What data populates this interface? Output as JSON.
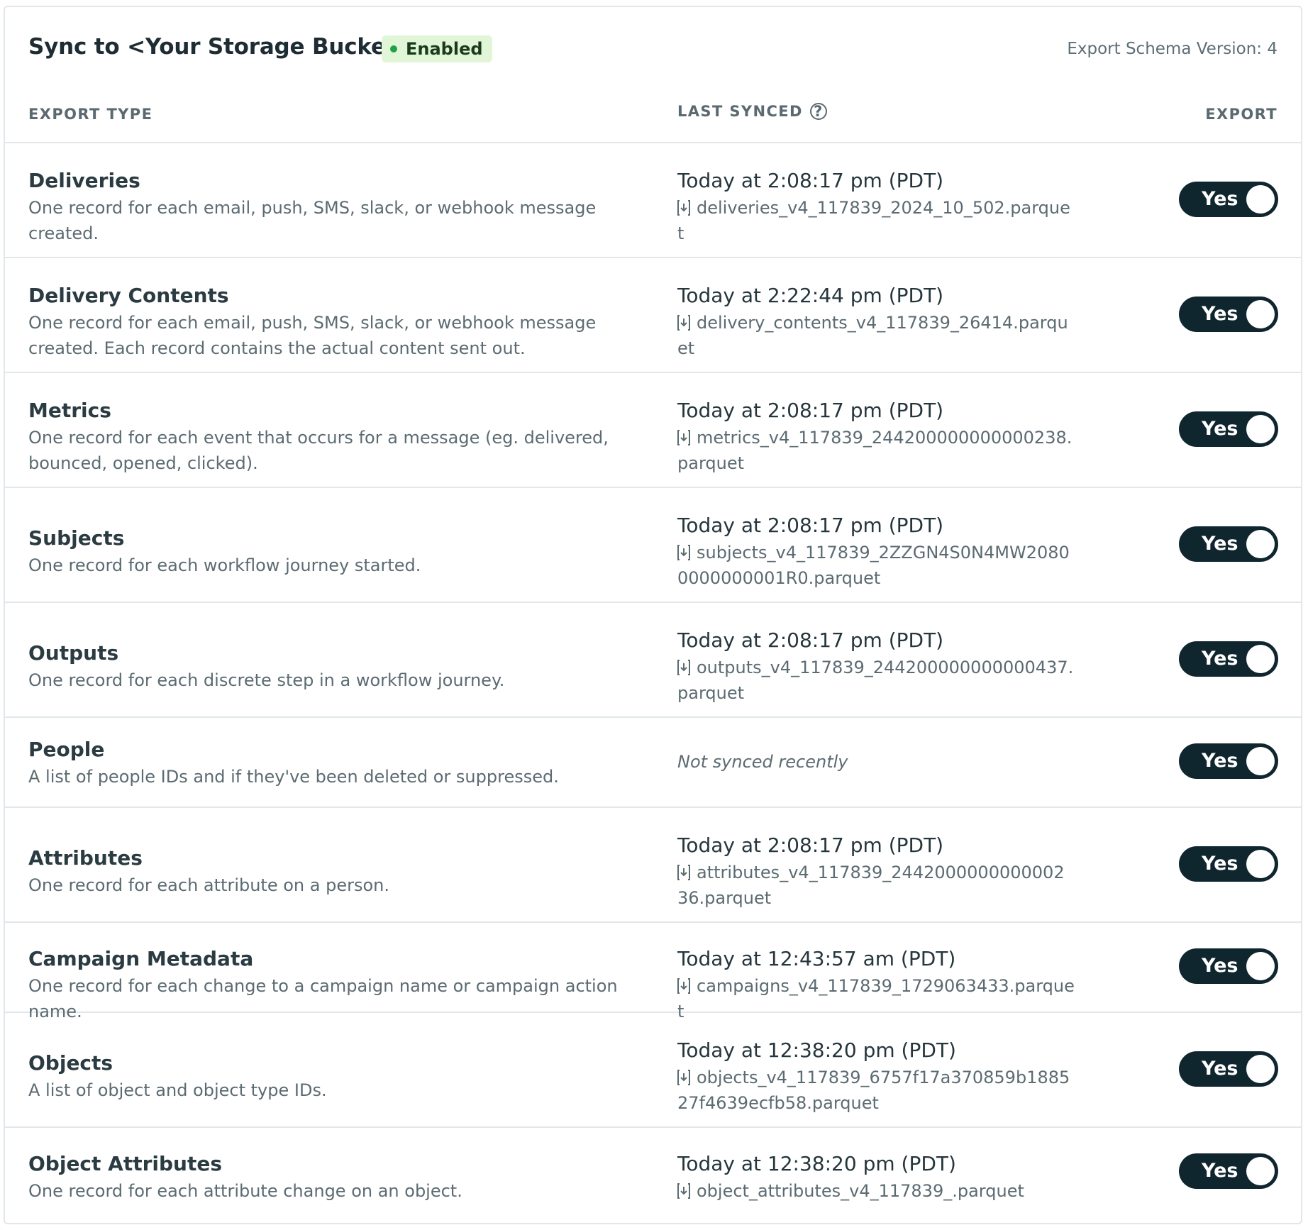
{
  "header": {
    "title": "Sync to <Your Storage Bucket>",
    "status": "Enabled",
    "schema_version": "Export Schema Version: 4"
  },
  "columns": {
    "export_type": "EXPORT TYPE",
    "last_synced": "LAST SYNCED",
    "export": "EXPORT"
  },
  "rows": [
    {
      "name": "Deliveries",
      "desc": "One record for each email, push, SMS, slack, or webhook message created.",
      "time": "Today at 2:08:17 pm (PDT)",
      "file": "deliveries_v4_117839_2024_10_502.parquet",
      "toggle": "Yes"
    },
    {
      "name": "Delivery Contents",
      "desc": "One record for each email, push, SMS, slack, or webhook message created. Each record contains the actual content sent out.",
      "time": "Today at 2:22:44 pm (PDT)",
      "file": "delivery_contents_v4_117839_26414.parquet",
      "toggle": "Yes"
    },
    {
      "name": "Metrics",
      "desc": "One record for each event that occurs for a message (eg. delivered, bounced, opened, clicked).",
      "time": "Today at 2:08:17 pm (PDT)",
      "file": "metrics_v4_117839_244200000000000238.parquet",
      "toggle": "Yes"
    },
    {
      "name": "Subjects",
      "desc": "One record for each workflow journey started.",
      "time": "Today at 2:08:17 pm (PDT)",
      "file": "subjects_v4_117839_2ZZGN4S0N4MW20800000000001R0.parquet",
      "toggle": "Yes"
    },
    {
      "name": "Outputs",
      "desc": "One record for each discrete step in a workflow journey.",
      "time": "Today at 2:08:17 pm (PDT)",
      "file": "outputs_v4_117839_244200000000000437.parquet",
      "toggle": "Yes"
    },
    {
      "name": "People",
      "desc": "A list of people IDs and if they've been deleted or suppressed.",
      "time": "",
      "file": "",
      "not_synced": "Not synced recently",
      "toggle": "Yes"
    },
    {
      "name": "Attributes",
      "desc": "One record for each attribute on a person.",
      "time": "Today at 2:08:17 pm (PDT)",
      "file": "attributes_v4_117839_244200000000000236.parquet",
      "toggle": "Yes"
    },
    {
      "name": "Campaign Metadata",
      "desc": "One record for each change to a campaign name or campaign action name.",
      "time": "Today at 12:43:57 am (PDT)",
      "file": "campaigns_v4_117839_1729063433.parquet",
      "toggle": "Yes"
    },
    {
      "name": "Objects",
      "desc": "A list of object and object type IDs.",
      "time": "Today at 12:38:20 pm (PDT)",
      "file": "objects_v4_117839_6757f17a370859b188527f4639ecfb58.parquet",
      "toggle": "Yes"
    },
    {
      "name": "Object Attributes",
      "desc": "One record for each attribute change on an object.",
      "time": "Today at 12:38:20 pm (PDT)",
      "file": "object_attributes_v4_117839_.parquet",
      "toggle": "Yes"
    }
  ],
  "colors": {
    "toggle_bg": "#10262f",
    "badge_bg": "#e1f6d6",
    "badge_dot": "#22a046"
  }
}
